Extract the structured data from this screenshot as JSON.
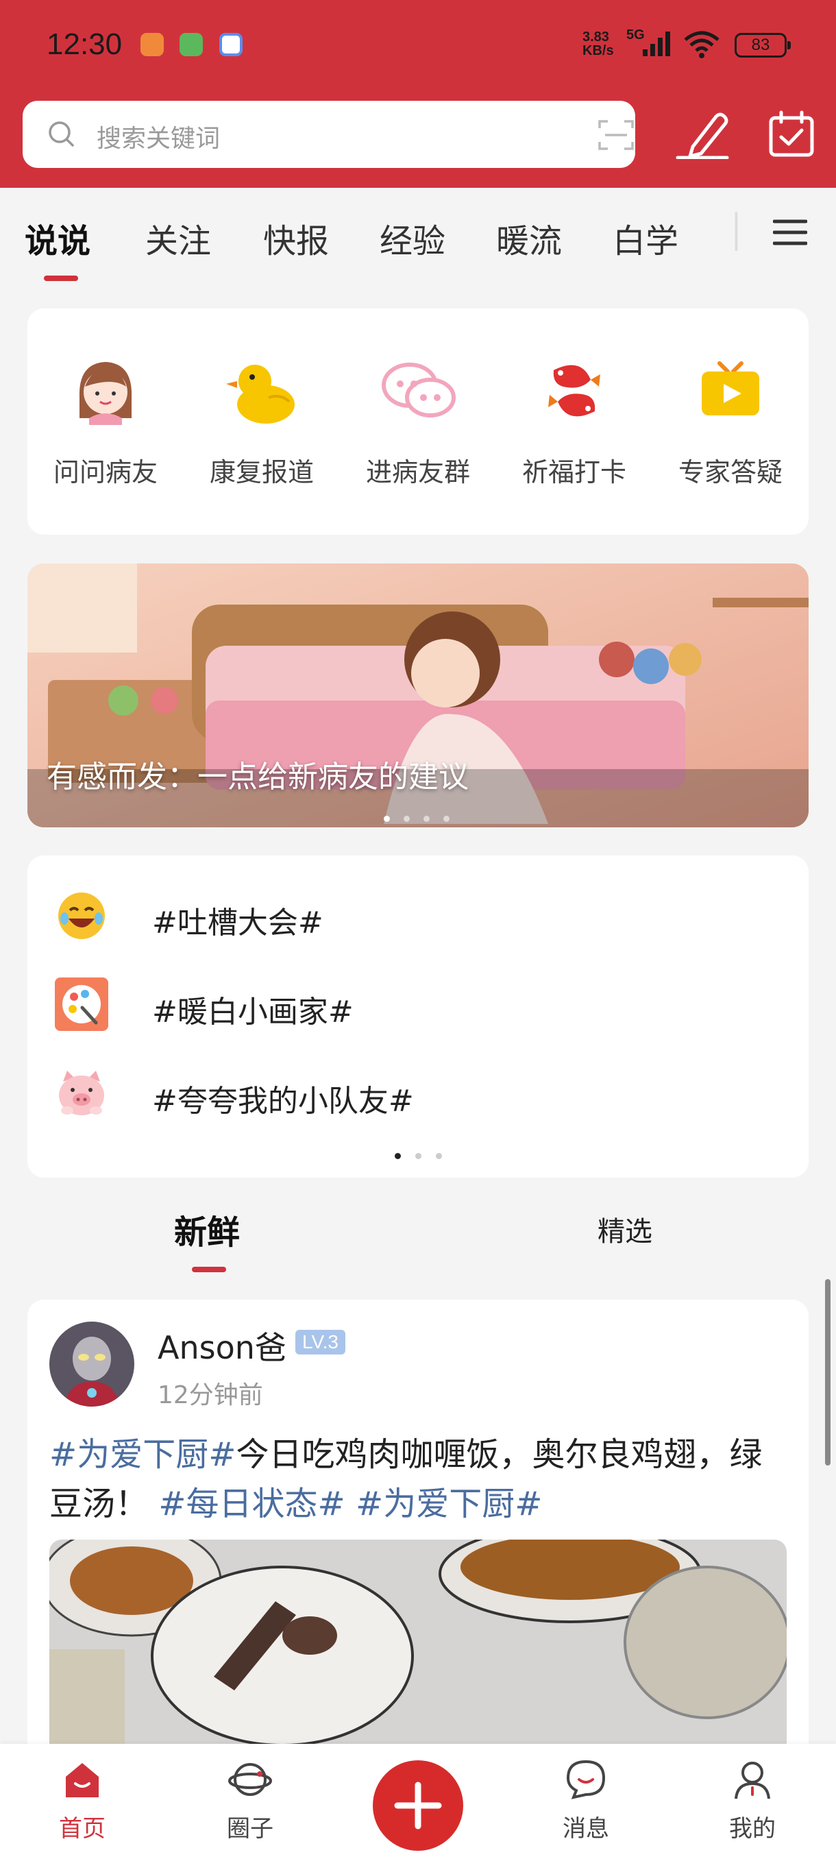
{
  "status_bar": {
    "time": "12:30",
    "net_speed": "3.83\nKB/s",
    "net_type": "5G",
    "battery": "83"
  },
  "search": {
    "placeholder": "搜索关键词"
  },
  "tabs": [
    "说说",
    "关注",
    "快报",
    "经验",
    "暖流",
    "白学"
  ],
  "active_tab": "说说",
  "quick_actions": [
    {
      "label": "问问病友",
      "icon": "girl-avatar-icon"
    },
    {
      "label": "康复报道",
      "icon": "rubber-duck-icon"
    },
    {
      "label": "进病友群",
      "icon": "chat-bubbles-icon"
    },
    {
      "label": "祈福打卡",
      "icon": "koi-fish-icon"
    },
    {
      "label": "专家答疑",
      "icon": "tv-play-icon"
    }
  ],
  "banner": {
    "caption": "有感而发：一点给新病友的建议",
    "page_count": 4,
    "active_index": 0
  },
  "topics": [
    {
      "label": "#吐槽大会#",
      "icon": "laughing-emoji-icon"
    },
    {
      "label": "#暖白小画家#",
      "icon": "palette-icon"
    },
    {
      "label": "#夸夸我的小队友#",
      "icon": "pig-face-icon"
    }
  ],
  "topic_pages": 3,
  "feed_tabs": {
    "fresh": "新鲜",
    "featured": "精选"
  },
  "post": {
    "username": "Anson爸",
    "level": "LV.3",
    "time": "12分钟前",
    "text_tag1": "#为爱下厨#",
    "text_body": "今日吃鸡肉咖喱饭，奥尔良鸡翅，绿豆汤！",
    "text_tag2": "#每日状态#",
    "text_tag3": "#为爱下厨#"
  },
  "bottom_nav": {
    "home": "首页",
    "circle": "圈子",
    "messages": "消息",
    "mine": "我的"
  },
  "colors": {
    "brand_red": "#d0323c",
    "tag_blue": "#4a6d9f"
  }
}
